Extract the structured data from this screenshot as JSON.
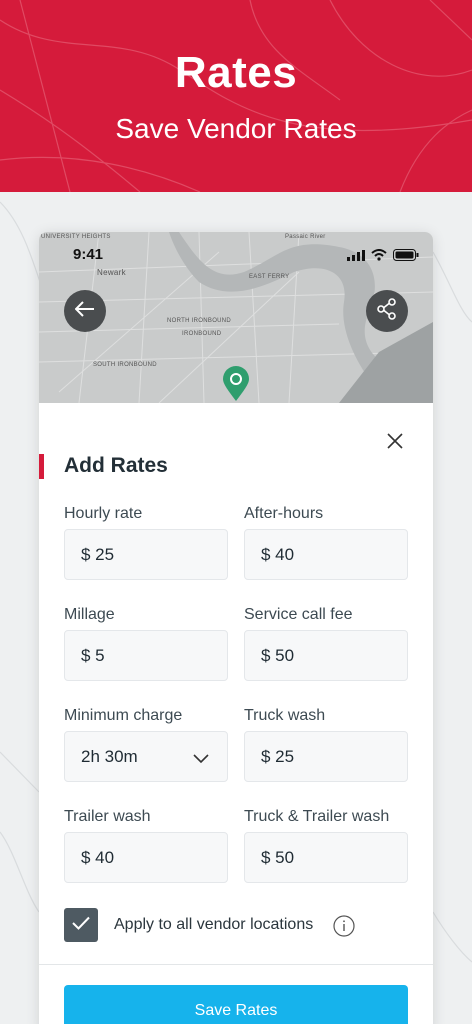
{
  "banner": {
    "title": "Rates",
    "subtitle": "Save Vendor Rates",
    "color": "#d51b3b"
  },
  "status": {
    "time": "9:41"
  },
  "map": {
    "labels": [
      "Newark",
      "EAST FERRY",
      "NORTH IRONBOUND",
      "IRONBOUND",
      "SOUTH IRONBOUND",
      "UNIVERSITY HEIGHTS",
      "Passaic River"
    ]
  },
  "form": {
    "title": "Add Rates",
    "fields": [
      {
        "label": "Hourly rate",
        "value": "$ 25"
      },
      {
        "label": "After-hours",
        "value": "$ 40"
      },
      {
        "label": "Millage",
        "value": "$ 5"
      },
      {
        "label": "Service call fee",
        "value": "$ 50"
      },
      {
        "label": "Minimum charge",
        "value": "2h 30m"
      },
      {
        "label": "Truck wash",
        "value": "$ 25"
      },
      {
        "label": "Trailer wash",
        "value": "$ 40"
      },
      {
        "label": "Truck & Trailer wash",
        "value": "$ 50"
      }
    ],
    "apply_all_label": "Apply to all vendor locations",
    "apply_all_checked": true,
    "save_label": "Save Rates",
    "accent_color": "#16b3ec"
  }
}
